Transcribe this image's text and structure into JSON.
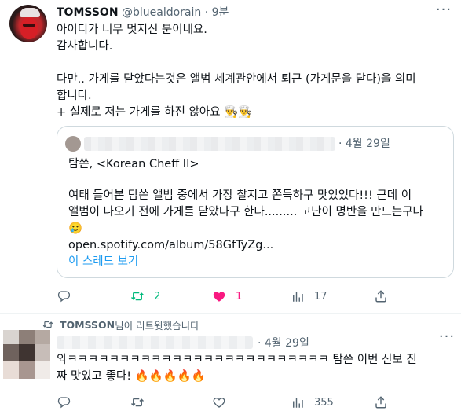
{
  "tweet1": {
    "name": "TOMSSON",
    "handle": "@bluealdorain",
    "dot": "·",
    "time": "9분",
    "lines": [
      "아이디가 너무 멋지신 분이네요.",
      "감사합니다.",
      "",
      "다만.. 가게를 닫았다는것은 앨범 세계관안에서 퇴근 (가게문을 닫다)을 의미",
      "합니다.",
      "+ 실제로 저는 가게를 하진 않아요 👨‍🍳👨‍🍳"
    ],
    "quote": {
      "time": "· 4월 29일",
      "line1": "탐쓴, <Korean Cheff II>",
      "line2": "여태 들어본 탐쓴 앨범 중에서 가장 찰지고 쫀득하구 맛있었다!!! 근데 이",
      "line3": "앨범이 나오기 전에 가게를 닫았다구 한다......... 고난이 명반을 만드는구나",
      "line4": "🥲",
      "link": "open.spotify.com/album/58GfTyZg...",
      "show_thread": "이 스레드 보기"
    },
    "stats": {
      "retweets": "2",
      "likes": "1",
      "views": "17"
    }
  },
  "retweet_notice": {
    "name": "TOMSSON",
    "suffix": " 님이 리트윗했습니다"
  },
  "tweet2": {
    "time": "· 4월 29일",
    "line1": "와ㅋㅋㅋㅋㅋㅋㅋㅋㅋㅋㅋㅋㅋㅋㅋㅋㅋㅋㅋㅋㅋㅋㅋㅋㅋ 탐쓴 이번 신보 진",
    "line2": "짜 맛있고 좋다! 🔥🔥🔥🔥🔥",
    "stats": {
      "views": "355"
    }
  },
  "icons": {
    "more": "more-icon",
    "reply": "reply-icon",
    "retweet": "retweet-icon",
    "like": "heart-icon",
    "views": "views-icon",
    "share": "share-icon"
  },
  "colors": {
    "text": "#0f1419",
    "secondary": "#536471",
    "link": "#1d9bf0",
    "retweet_green": "#00ba7c",
    "like_pink": "#f91880",
    "border": "#cfd9de"
  }
}
